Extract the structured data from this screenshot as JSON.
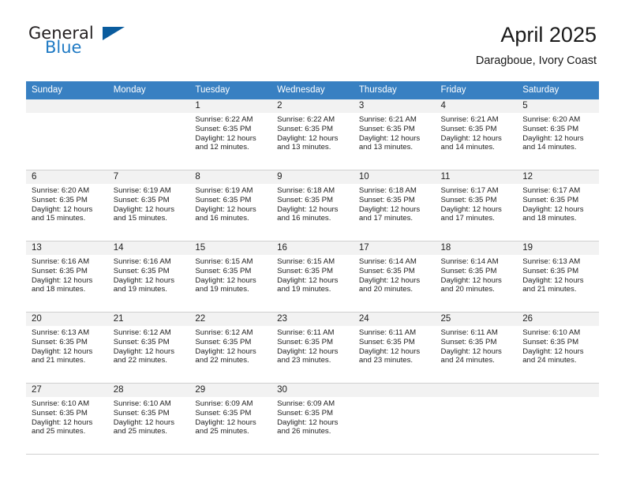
{
  "brand": {
    "name_part1": "General",
    "name_part2": "Blue",
    "flag_icon": "blue-triangle-flag"
  },
  "header": {
    "title": "April 2025",
    "subtitle": "Daragboue, Ivory Coast",
    "accent_color": "#3880c2",
    "brand_blue": "#1f7ac4"
  },
  "calendar": {
    "weekday_headers": [
      "Sunday",
      "Monday",
      "Tuesday",
      "Wednesday",
      "Thursday",
      "Friday",
      "Saturday"
    ],
    "labels": {
      "sunrise": "Sunrise:",
      "sunset": "Sunset:",
      "daylight": "Daylight:"
    },
    "weeks": [
      [
        {
          "day": "",
          "empty": true
        },
        {
          "day": "",
          "empty": true
        },
        {
          "day": "1",
          "sunrise": "Sunrise: 6:22 AM",
          "sunset": "Sunset: 6:35 PM",
          "daylight_line1": "Daylight: 12 hours",
          "daylight_line2": "and 12 minutes."
        },
        {
          "day": "2",
          "sunrise": "Sunrise: 6:22 AM",
          "sunset": "Sunset: 6:35 PM",
          "daylight_line1": "Daylight: 12 hours",
          "daylight_line2": "and 13 minutes."
        },
        {
          "day": "3",
          "sunrise": "Sunrise: 6:21 AM",
          "sunset": "Sunset: 6:35 PM",
          "daylight_line1": "Daylight: 12 hours",
          "daylight_line2": "and 13 minutes."
        },
        {
          "day": "4",
          "sunrise": "Sunrise: 6:21 AM",
          "sunset": "Sunset: 6:35 PM",
          "daylight_line1": "Daylight: 12 hours",
          "daylight_line2": "and 14 minutes."
        },
        {
          "day": "5",
          "sunrise": "Sunrise: 6:20 AM",
          "sunset": "Sunset: 6:35 PM",
          "daylight_line1": "Daylight: 12 hours",
          "daylight_line2": "and 14 minutes."
        }
      ],
      [
        {
          "day": "6",
          "sunrise": "Sunrise: 6:20 AM",
          "sunset": "Sunset: 6:35 PM",
          "daylight_line1": "Daylight: 12 hours",
          "daylight_line2": "and 15 minutes."
        },
        {
          "day": "7",
          "sunrise": "Sunrise: 6:19 AM",
          "sunset": "Sunset: 6:35 PM",
          "daylight_line1": "Daylight: 12 hours",
          "daylight_line2": "and 15 minutes."
        },
        {
          "day": "8",
          "sunrise": "Sunrise: 6:19 AM",
          "sunset": "Sunset: 6:35 PM",
          "daylight_line1": "Daylight: 12 hours",
          "daylight_line2": "and 16 minutes."
        },
        {
          "day": "9",
          "sunrise": "Sunrise: 6:18 AM",
          "sunset": "Sunset: 6:35 PM",
          "daylight_line1": "Daylight: 12 hours",
          "daylight_line2": "and 16 minutes."
        },
        {
          "day": "10",
          "sunrise": "Sunrise: 6:18 AM",
          "sunset": "Sunset: 6:35 PM",
          "daylight_line1": "Daylight: 12 hours",
          "daylight_line2": "and 17 minutes."
        },
        {
          "day": "11",
          "sunrise": "Sunrise: 6:17 AM",
          "sunset": "Sunset: 6:35 PM",
          "daylight_line1": "Daylight: 12 hours",
          "daylight_line2": "and 17 minutes."
        },
        {
          "day": "12",
          "sunrise": "Sunrise: 6:17 AM",
          "sunset": "Sunset: 6:35 PM",
          "daylight_line1": "Daylight: 12 hours",
          "daylight_line2": "and 18 minutes."
        }
      ],
      [
        {
          "day": "13",
          "sunrise": "Sunrise: 6:16 AM",
          "sunset": "Sunset: 6:35 PM",
          "daylight_line1": "Daylight: 12 hours",
          "daylight_line2": "and 18 minutes."
        },
        {
          "day": "14",
          "sunrise": "Sunrise: 6:16 AM",
          "sunset": "Sunset: 6:35 PM",
          "daylight_line1": "Daylight: 12 hours",
          "daylight_line2": "and 19 minutes."
        },
        {
          "day": "15",
          "sunrise": "Sunrise: 6:15 AM",
          "sunset": "Sunset: 6:35 PM",
          "daylight_line1": "Daylight: 12 hours",
          "daylight_line2": "and 19 minutes."
        },
        {
          "day": "16",
          "sunrise": "Sunrise: 6:15 AM",
          "sunset": "Sunset: 6:35 PM",
          "daylight_line1": "Daylight: 12 hours",
          "daylight_line2": "and 19 minutes."
        },
        {
          "day": "17",
          "sunrise": "Sunrise: 6:14 AM",
          "sunset": "Sunset: 6:35 PM",
          "daylight_line1": "Daylight: 12 hours",
          "daylight_line2": "and 20 minutes."
        },
        {
          "day": "18",
          "sunrise": "Sunrise: 6:14 AM",
          "sunset": "Sunset: 6:35 PM",
          "daylight_line1": "Daylight: 12 hours",
          "daylight_line2": "and 20 minutes."
        },
        {
          "day": "19",
          "sunrise": "Sunrise: 6:13 AM",
          "sunset": "Sunset: 6:35 PM",
          "daylight_line1": "Daylight: 12 hours",
          "daylight_line2": "and 21 minutes."
        }
      ],
      [
        {
          "day": "20",
          "sunrise": "Sunrise: 6:13 AM",
          "sunset": "Sunset: 6:35 PM",
          "daylight_line1": "Daylight: 12 hours",
          "daylight_line2": "and 21 minutes."
        },
        {
          "day": "21",
          "sunrise": "Sunrise: 6:12 AM",
          "sunset": "Sunset: 6:35 PM",
          "daylight_line1": "Daylight: 12 hours",
          "daylight_line2": "and 22 minutes."
        },
        {
          "day": "22",
          "sunrise": "Sunrise: 6:12 AM",
          "sunset": "Sunset: 6:35 PM",
          "daylight_line1": "Daylight: 12 hours",
          "daylight_line2": "and 22 minutes."
        },
        {
          "day": "23",
          "sunrise": "Sunrise: 6:11 AM",
          "sunset": "Sunset: 6:35 PM",
          "daylight_line1": "Daylight: 12 hours",
          "daylight_line2": "and 23 minutes."
        },
        {
          "day": "24",
          "sunrise": "Sunrise: 6:11 AM",
          "sunset": "Sunset: 6:35 PM",
          "daylight_line1": "Daylight: 12 hours",
          "daylight_line2": "and 23 minutes."
        },
        {
          "day": "25",
          "sunrise": "Sunrise: 6:11 AM",
          "sunset": "Sunset: 6:35 PM",
          "daylight_line1": "Daylight: 12 hours",
          "daylight_line2": "and 24 minutes."
        },
        {
          "day": "26",
          "sunrise": "Sunrise: 6:10 AM",
          "sunset": "Sunset: 6:35 PM",
          "daylight_line1": "Daylight: 12 hours",
          "daylight_line2": "and 24 minutes."
        }
      ],
      [
        {
          "day": "27",
          "sunrise": "Sunrise: 6:10 AM",
          "sunset": "Sunset: 6:35 PM",
          "daylight_line1": "Daylight: 12 hours",
          "daylight_line2": "and 25 minutes."
        },
        {
          "day": "28",
          "sunrise": "Sunrise: 6:10 AM",
          "sunset": "Sunset: 6:35 PM",
          "daylight_line1": "Daylight: 12 hours",
          "daylight_line2": "and 25 minutes."
        },
        {
          "day": "29",
          "sunrise": "Sunrise: 6:09 AM",
          "sunset": "Sunset: 6:35 PM",
          "daylight_line1": "Daylight: 12 hours",
          "daylight_line2": "and 25 minutes."
        },
        {
          "day": "30",
          "sunrise": "Sunrise: 6:09 AM",
          "sunset": "Sunset: 6:35 PM",
          "daylight_line1": "Daylight: 12 hours",
          "daylight_line2": "and 26 minutes."
        },
        {
          "day": "",
          "empty": true
        },
        {
          "day": "",
          "empty": true
        },
        {
          "day": "",
          "empty": true
        }
      ]
    ]
  }
}
